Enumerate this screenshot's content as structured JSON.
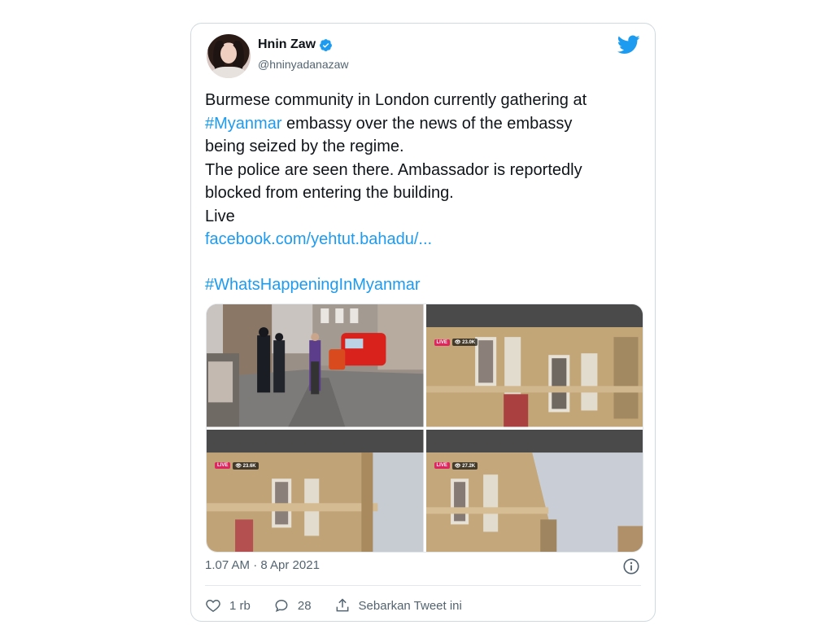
{
  "user": {
    "display_name": "Hnin Zaw",
    "handle": "@hninyadanazaw",
    "verified": true
  },
  "tweet": {
    "line1": "Burmese community in London currently gathering at",
    "hashtag1": "#Myanmar",
    "line2_rest": " embassy over the news of the embassy",
    "line3": "being seized by the regime.",
    "line4": "The police are seen there. Ambassador is reportedly",
    "line5": "blocked from entering the building.",
    "line6": "Live",
    "link": "facebook.com/yehtut.bahadu/...",
    "hashtag2": "#WhatsHappeningInMyanmar"
  },
  "media": [
    {
      "icon": "street-photo"
    },
    {
      "icon": "building-photo",
      "live_label": "LIVE",
      "viewers": "👁 23.0K"
    },
    {
      "icon": "building-photo",
      "live_label": "LIVE",
      "viewers": "👁 23.6K"
    },
    {
      "icon": "building-photo",
      "live_label": "LIVE",
      "viewers": "👁 27.2K"
    }
  ],
  "meta": {
    "timestamp": "1.07 AM · 8 Apr 2021"
  },
  "actions": {
    "likes": "1 rb",
    "replies": "28",
    "share_label": "Sebarkan Tweet ini"
  },
  "colors": {
    "link": "#1d9bf0",
    "text": "#0f1419",
    "secondary": "#536471",
    "border": "#cfd9de",
    "live": "#e0245e"
  }
}
